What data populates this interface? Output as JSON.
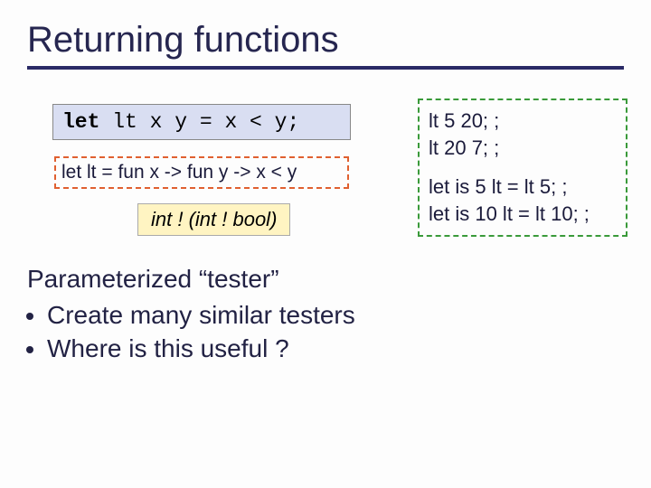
{
  "title": "Returning functions",
  "code_box": {
    "keyword": "let",
    "rest": " lt x y = x < y;"
  },
  "expand_box": "let lt = fun x -> fun y -> x < y",
  "type_box": "int  ! (int  ! bool)",
  "body": {
    "heading": "Parameterized “tester”",
    "bullets": [
      "Create many similar testers",
      "Where is this useful ?"
    ]
  },
  "right_box": {
    "lines1": [
      "lt 5 20; ;",
      "lt 20 7; ;"
    ],
    "lines2": [
      "let is 5 lt = lt 5; ;",
      "let is 10 lt = lt 10; ;"
    ]
  }
}
